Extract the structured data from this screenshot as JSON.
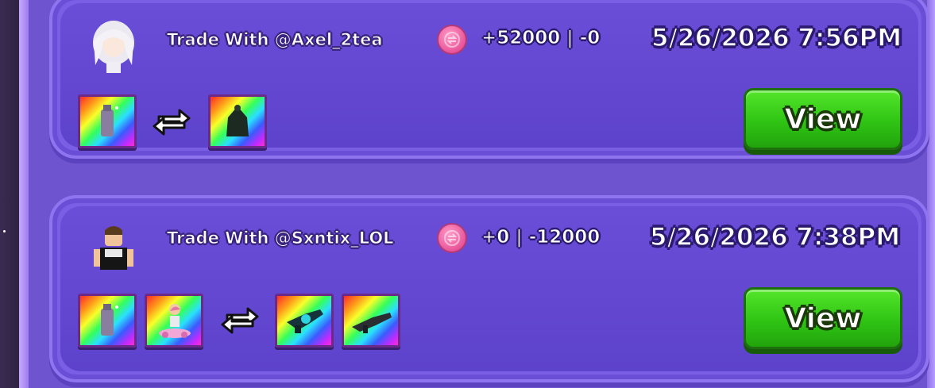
{
  "trades": [
    {
      "title": "Trade With @Axel_2tea",
      "balance": "+52000 | -0",
      "datetime": "5/26/2026 7:56PM",
      "view_label": "View",
      "avatar_icon": "white-hair-avatar-icon",
      "give_items": [
        "spray-can-item-icon"
      ],
      "receive_items": [
        "dark-lantern-item-icon"
      ]
    },
    {
      "title": "Trade With @Sxntix_LOL",
      "balance": "+0 | -12000",
      "datetime": "5/26/2026 7:38PM",
      "view_label": "View",
      "avatar_icon": "classic-noob-avatar-icon",
      "give_items": [
        "spray-can-item-icon",
        "hoverboard-item-icon"
      ],
      "receive_items": [
        "teal-blaster-item-icon",
        "dark-rifle-item-icon"
      ]
    }
  ],
  "colors": {
    "panel": "#6e54cf",
    "card": "#5d42cc",
    "button": "#2fc414",
    "coin": "#e9559a"
  }
}
